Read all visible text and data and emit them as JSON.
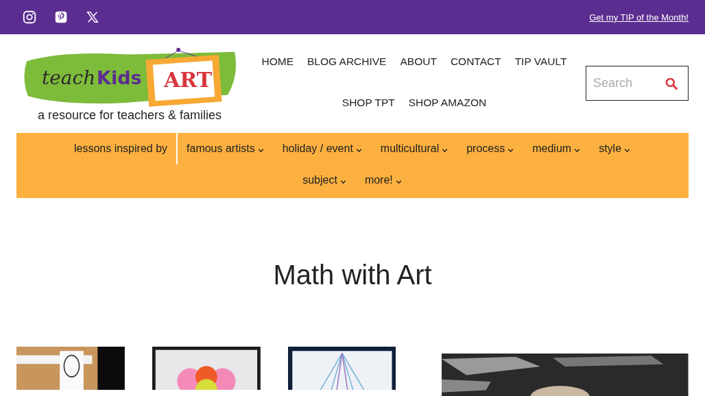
{
  "top_bar": {
    "social": [
      {
        "kind": "instagram"
      },
      {
        "kind": "pinterest"
      },
      {
        "kind": "x"
      }
    ],
    "promo_link": "Get my TIP of the Month!"
  },
  "logo": {
    "word_1": "teach",
    "word_2": "Kids",
    "word_3": "ART",
    "tagline": "a resource for teachers & families"
  },
  "main_nav": [
    "HOME",
    "BLOG ARCHIVE",
    "ABOUT",
    "CONTACT",
    "TIP VAULT",
    "SHOP TPT",
    "SHOP AMAZON"
  ],
  "search": {
    "placeholder": "Search"
  },
  "category_nav": {
    "label": "lessons inspired by",
    "items": [
      "famous artists",
      "holiday / event",
      "multicultural",
      "process",
      "medium",
      "style",
      "subject",
      "more!"
    ]
  },
  "page_title": "Math with Art",
  "posts": [
    {
      "kind": "picture"
    },
    {
      "kind": "picture"
    },
    {
      "kind": "picture"
    },
    {
      "kind": "picture"
    }
  ]
}
